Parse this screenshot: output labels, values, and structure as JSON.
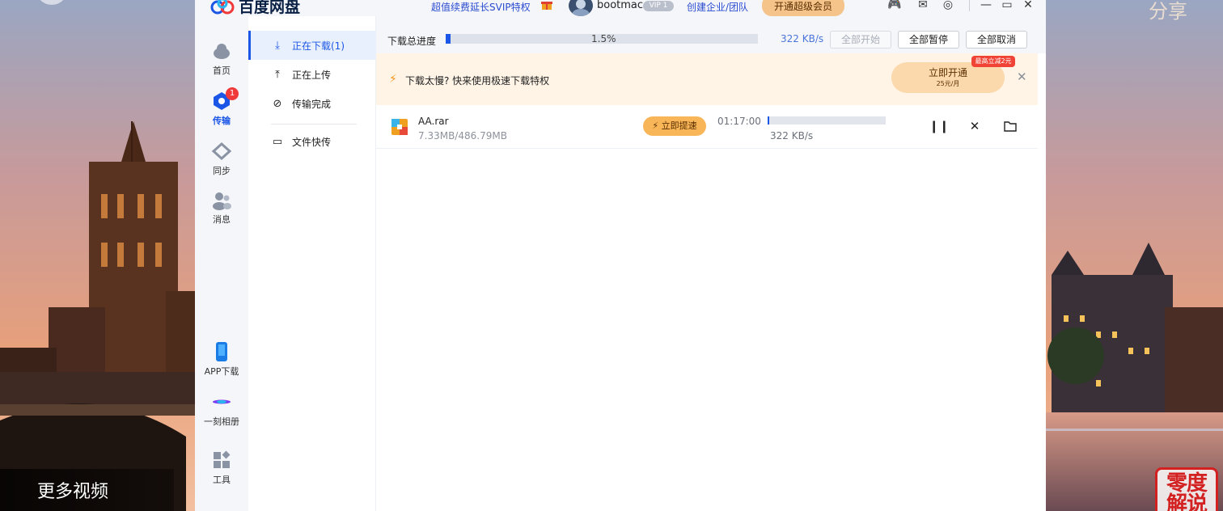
{
  "overlay": {
    "more_videos": "更多视频",
    "top_right": "分享",
    "badge_line1": "零度",
    "badge_line2": "解说"
  },
  "app": {
    "name": "百度网盘",
    "svip_promo": "超值续费延长SVIP特权",
    "username": "bootmac",
    "vip_tag": "VIP 1",
    "enterprise": "创建企业/团队",
    "open_svip": "开通超级会员"
  },
  "nav": {
    "home": "首页",
    "transfer": "传输",
    "transfer_badge": "1",
    "sync": "同步",
    "messages": "消息",
    "app_download": "APP下载",
    "album": "一刻相册",
    "tools": "工具"
  },
  "subnav": {
    "downloading": "正在下载(1)",
    "uploading": "正在上传",
    "completed": "传输完成",
    "quick_transfer": "文件快传"
  },
  "toolbar": {
    "progress_label": "下载总进度",
    "progress_percent": "1.5%",
    "progress_fraction": 0.015,
    "speed": "322 KB/s",
    "start_all": "全部开始",
    "pause_all": "全部暂停",
    "cancel_all": "全部取消"
  },
  "promo": {
    "text": "下载太慢? 快来使用极速下载特权",
    "open_now": "立即开通",
    "price": "25元/月",
    "discount": "最高立减2元"
  },
  "downloads": [
    {
      "name": "AA.rar",
      "size": "7.33MB/486.79MB",
      "boost": "立即提速",
      "time_left": "01:17:00",
      "speed": "322 KB/s",
      "progress": 0.015
    }
  ],
  "colors": {
    "accent": "#1c56e6",
    "promo_bg": "#fff4e6",
    "boost": "#f8b658"
  }
}
